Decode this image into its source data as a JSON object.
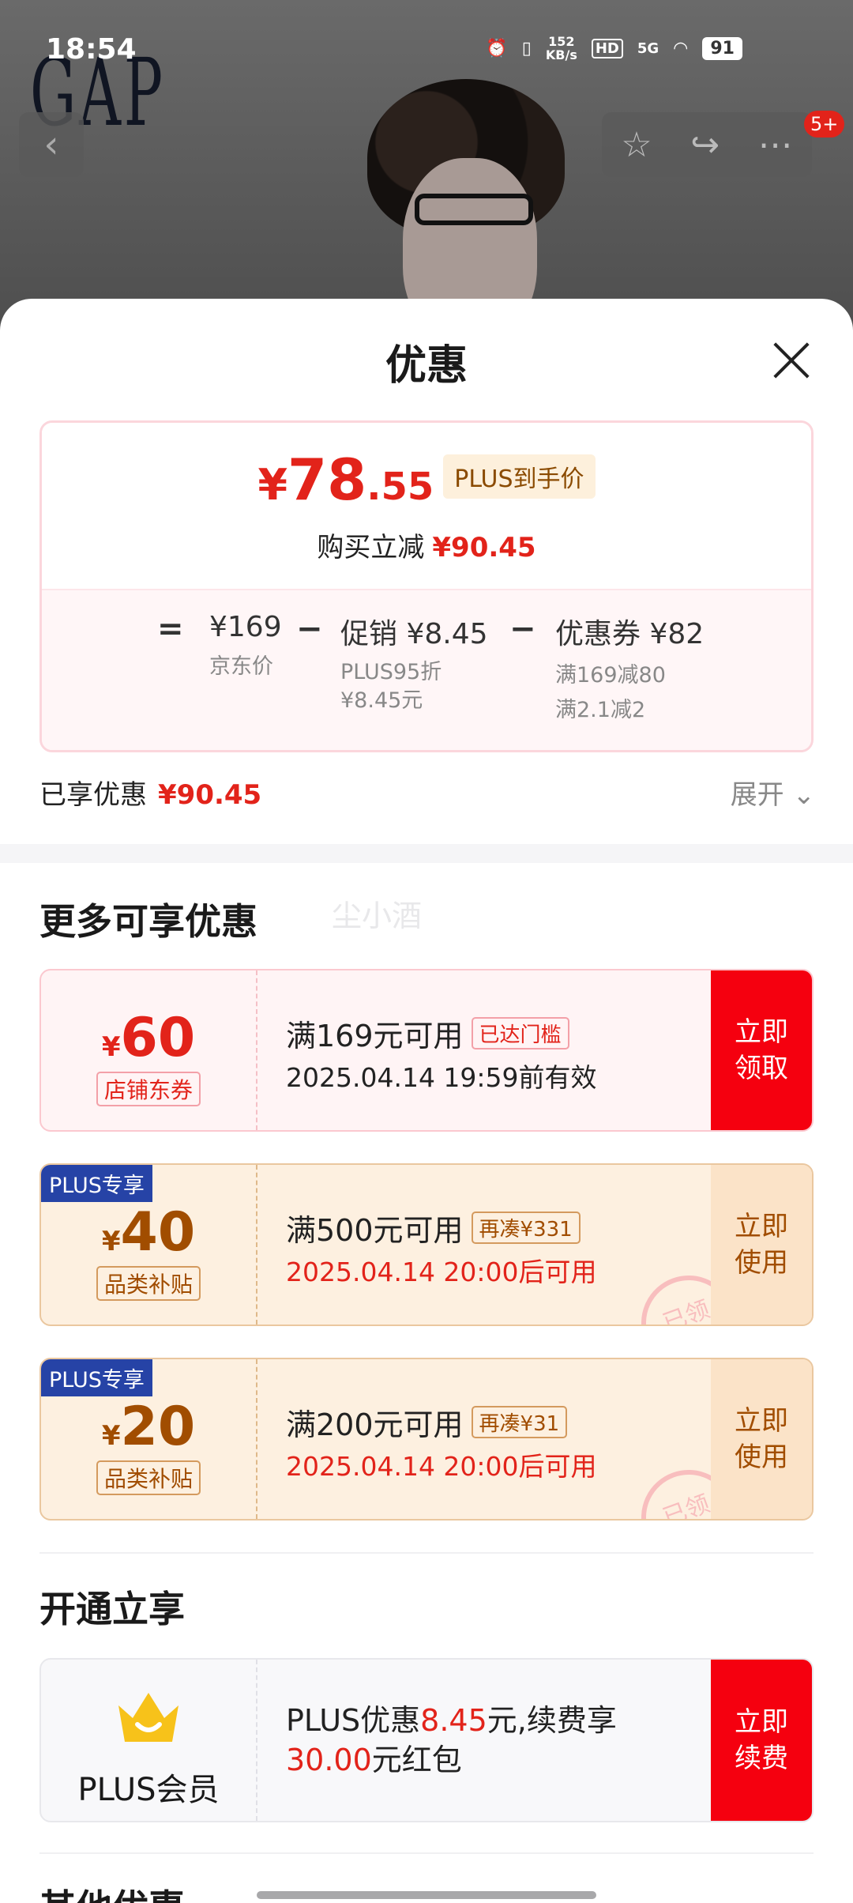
{
  "status_bar": {
    "time": "18:54",
    "net_speed_value": "152",
    "net_speed_unit": "KB/s",
    "hd": "HD",
    "signal": "5G",
    "battery": "91"
  },
  "backdrop": {
    "brand": "GAP"
  },
  "nav": {
    "notification_badge": "5+"
  },
  "sheet": {
    "title": "优惠",
    "summary": {
      "currency": "¥",
      "final_price_int": "78",
      "final_price_dec": ".55",
      "price_tag": "PLUS到手价",
      "reduce_label": "购买立减",
      "reduce_value": "¥90.45",
      "breakdown": {
        "eq": "=",
        "minus": "−",
        "jd_price": "¥169",
        "jd_price_label": "京东价",
        "promo": "促销 ¥8.45",
        "promo_note_1": "PLUS95折",
        "promo_note_2": "¥8.45元",
        "coupon": "优惠券 ¥82",
        "coupon_note_1": "满169减80",
        "coupon_note_2": "满2.1减2"
      }
    },
    "enjoyed_label": "已享优惠",
    "enjoyed_value": "¥90.45",
    "expand_label": "展开",
    "more_title": "更多可享优惠",
    "ghost_text": "尘小酒",
    "coupons": [
      {
        "currency": "¥",
        "amount": "60",
        "type": "店铺东券",
        "condition": "满169元可用",
        "tag": "已达门槛",
        "date": "2025.04.14 19:59前有效",
        "button": "立即\n领取",
        "plus_label": ""
      },
      {
        "currency": "¥",
        "amount": "40",
        "type": "品类补贴",
        "condition": "满500元可用",
        "tag": "再凑¥331",
        "date": "2025.04.14 20:00后可用",
        "button": "立即\n使用",
        "plus_label": "PLUS专享",
        "stamp": "已领"
      },
      {
        "currency": "¥",
        "amount": "20",
        "type": "品类补贴",
        "condition": "满200元可用",
        "tag": "再凑¥31",
        "date": "2025.04.14 20:00后可用",
        "button": "立即\n使用",
        "plus_label": "PLUS专享",
        "stamp": "已领"
      }
    ],
    "open_title": "开通立享",
    "plus_card": {
      "member_label": "PLUS会员",
      "text_1": "PLUS优惠",
      "text_red_1": "8.45",
      "text_2": "元,续费享",
      "text_red_2": "30.00",
      "text_3": "元红包",
      "button": "立即\n续费"
    },
    "other_title": "其他优惠"
  },
  "colors": {
    "accent_red": "#e2231a",
    "plus_blue": "#2643a6",
    "gold_text": "#b05a00"
  }
}
